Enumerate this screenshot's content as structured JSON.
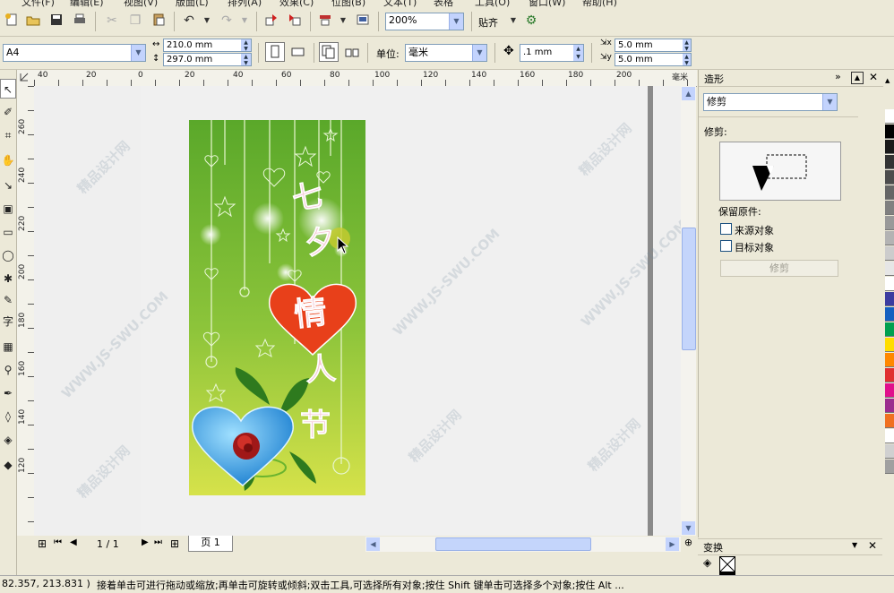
{
  "menu": [
    "文件(F)",
    "编辑(E)",
    "视图(V)",
    "版面(L)",
    "排列(A)",
    "效果(C)",
    "位图(B)",
    "文本(T)",
    "表格",
    "工具(O)",
    "窗口(W)",
    "帮助(H)"
  ],
  "toolbar": {
    "zoom_value": "200%",
    "snap_label": "贴齐"
  },
  "propbar": {
    "paper_size": "A4",
    "width": "210.0 mm",
    "height": "297.0 mm",
    "unit_label": "单位:",
    "unit_value": "毫米",
    "nudge": ".1 mm",
    "dup_x": "5.0 mm",
    "dup_y": "5.0 mm"
  },
  "ruler": {
    "h_labels": [
      "40",
      "20",
      "0",
      "20",
      "40",
      "60",
      "80",
      "100",
      "120",
      "140",
      "160",
      "180",
      "200"
    ],
    "h_unit": "毫米",
    "v_labels": [
      "260",
      "240",
      "220",
      "200",
      "180",
      "160",
      "140",
      "120"
    ]
  },
  "design": {
    "title_chars": [
      "七",
      "夕",
      "情",
      "人",
      "节"
    ]
  },
  "pagebar": {
    "page_count": "1 / 1",
    "page_tab": "页 1"
  },
  "docker": {
    "title": "造形",
    "mode": "修剪",
    "section_label": "修剪:",
    "keep_label": "保留原件:",
    "source_label": "来源对象",
    "target_label": "目标对象",
    "apply_button": "修剪",
    "lower_title": "变换"
  },
  "status": {
    "coords": "82.357, 213.831 )",
    "hint": "接着单击可进行拖动或缩放;再单击可旋转或倾斜;双击工具,可选择所有对象;按住 Shift 键单击可选择多个对象;按住 Alt ..."
  },
  "watermark_text": "WWW.JS-SWU.COM",
  "watermark_cn": "精品设计网",
  "palette_colors": [
    "#ffffff",
    "#000000",
    "#1a1a1a",
    "#333333",
    "#4d4d4d",
    "#666666",
    "#808080",
    "#999999",
    "#b3b3b3",
    "#cccccc",
    "#e6e6e6",
    "#ffffff",
    "#3c3ca0",
    "#1560c0",
    "#00a050",
    "#ffdd00",
    "#ff8800",
    "#e03030",
    "#e0108c",
    "#9b2d8f",
    "#f07020",
    "#ffffff",
    "#d0d0d0",
    "#a0a0a0"
  ]
}
